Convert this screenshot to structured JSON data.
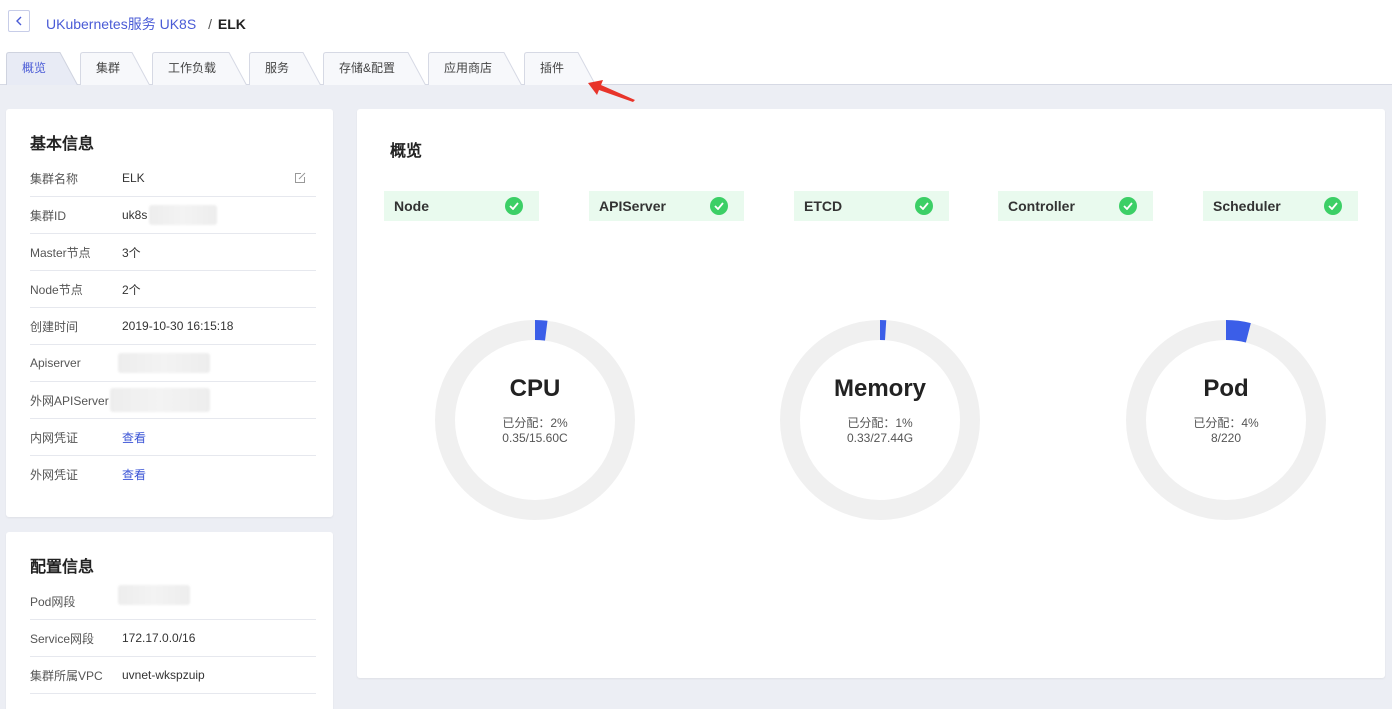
{
  "breadcrumb": {
    "parent": "UKubernetes服务 UK8S",
    "separator": "/",
    "current": "ELK"
  },
  "tabs": [
    {
      "label": "概览",
      "active": true
    },
    {
      "label": "集群",
      "active": false
    },
    {
      "label": "工作负载",
      "active": false
    },
    {
      "label": "服务",
      "active": false
    },
    {
      "label": "存储&配置",
      "active": false
    },
    {
      "label": "应用商店",
      "active": false
    },
    {
      "label": "插件",
      "active": false
    }
  ],
  "basic_info": {
    "title": "基本信息",
    "rows": [
      {
        "label": "集群名称",
        "value": "ELK"
      },
      {
        "label": "集群ID",
        "value": "uk8s"
      },
      {
        "label": "Master节点",
        "value": "3个"
      },
      {
        "label": "Node节点",
        "value": "2个"
      },
      {
        "label": "创建时间",
        "value": "2019-10-30 16:15:18"
      },
      {
        "label": "Apiserver",
        "value": ""
      },
      {
        "label": "外网APIServer",
        "value": ""
      },
      {
        "label": "内网凭证",
        "value": "查看"
      },
      {
        "label": "外网凭证",
        "value": "查看"
      }
    ]
  },
  "config_info": {
    "title": "配置信息",
    "rows": [
      {
        "label": "Pod网段",
        "value": ""
      },
      {
        "label": "Service网段",
        "value": "172.17.0.0/16"
      },
      {
        "label": "集群所属VPC",
        "value": "uvnet-wkspzuip"
      }
    ]
  },
  "overview": {
    "title": "概览",
    "status": [
      {
        "name": "Node",
        "ok": true
      },
      {
        "name": "APIServer",
        "ok": true
      },
      {
        "name": "ETCD",
        "ok": true
      },
      {
        "name": "Controller",
        "ok": true
      },
      {
        "name": "Scheduler",
        "ok": true
      }
    ],
    "gauges": [
      {
        "title": "CPU",
        "allocated": "已分配：2%",
        "usage": "0.35/15.60C",
        "percent": 2
      },
      {
        "title": "Memory",
        "allocated": "已分配：1%",
        "usage": "0.33/27.44G",
        "percent": 1
      },
      {
        "title": "Pod",
        "allocated": "已分配：4%",
        "usage": "8/220",
        "percent": 4
      }
    ]
  },
  "colors": {
    "accent": "#4a5bd6",
    "ok": "#3ccf66",
    "gauge_fill": "#3b5ee8",
    "gauge_track": "#f0f0f0",
    "arrow": "#e8342a"
  }
}
